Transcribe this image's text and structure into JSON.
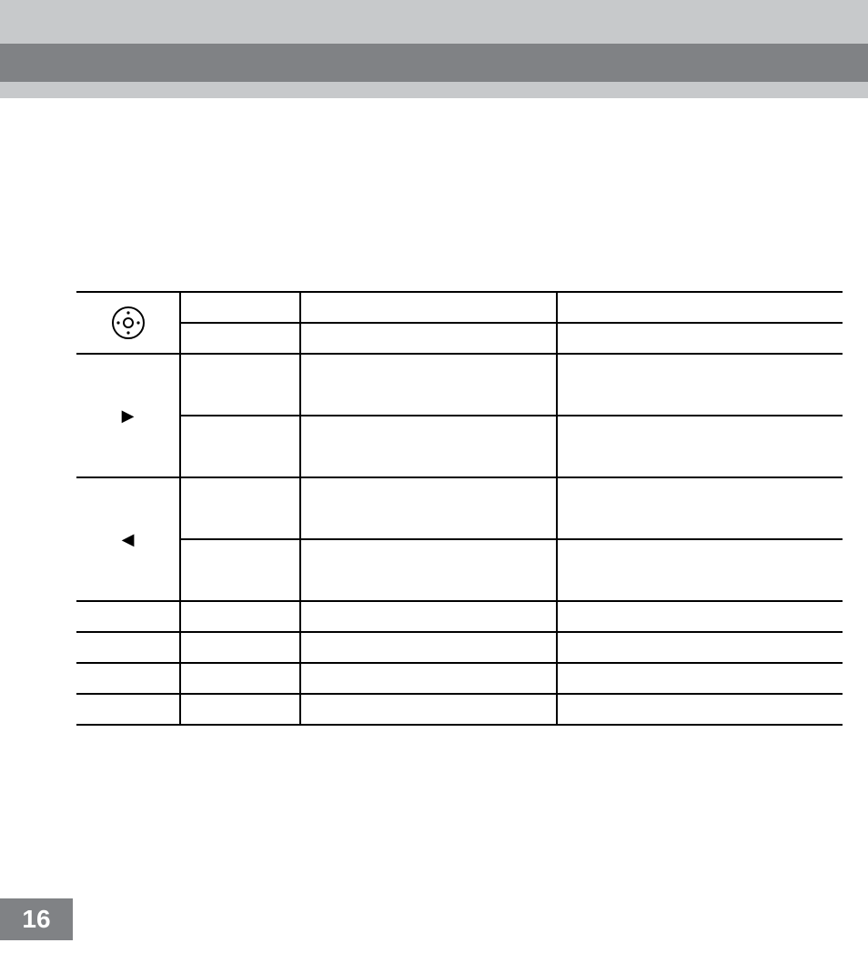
{
  "page_number": "16",
  "table": {
    "rows": [
      {
        "c0_icon": "dial",
        "c0_rowspan": 2,
        "heights": [
          34,
          34
        ]
      },
      {},
      {
        "c0_icon": "tri-right",
        "c0_rowspan": 2,
        "heights": [
          68,
          68
        ]
      },
      {},
      {
        "c0_icon": "tri-left",
        "c0_rowspan": 2,
        "heights": [
          68,
          68
        ]
      },
      {},
      {
        "heights": [
          34
        ]
      },
      {
        "heights": [
          34
        ]
      },
      {
        "heights": [
          34
        ]
      },
      {
        "heights": [
          34
        ]
      }
    ],
    "cells": {
      "r0c1": "",
      "r0c2": "",
      "r0c3": "",
      "r1c1": "",
      "r1c2": "",
      "r1c3": "",
      "r2c1": "",
      "r2c2": "",
      "r2c3": "",
      "r3c1": "",
      "r3c2": "",
      "r3c3": "",
      "r4c1": "",
      "r4c2": "",
      "r4c3": "",
      "r5c1": "",
      "r5c2": "",
      "r5c3": "",
      "r6c0": "",
      "r6c1": "",
      "r6c2": "",
      "r6c3": "",
      "r7c0": "",
      "r7c1": "",
      "r7c2": "",
      "r7c3": "",
      "r8c0": "",
      "r8c1": "",
      "r8c2": "",
      "r8c3": "",
      "r9c0": "",
      "r9c1": "",
      "r9c2": "",
      "r9c3": ""
    }
  }
}
